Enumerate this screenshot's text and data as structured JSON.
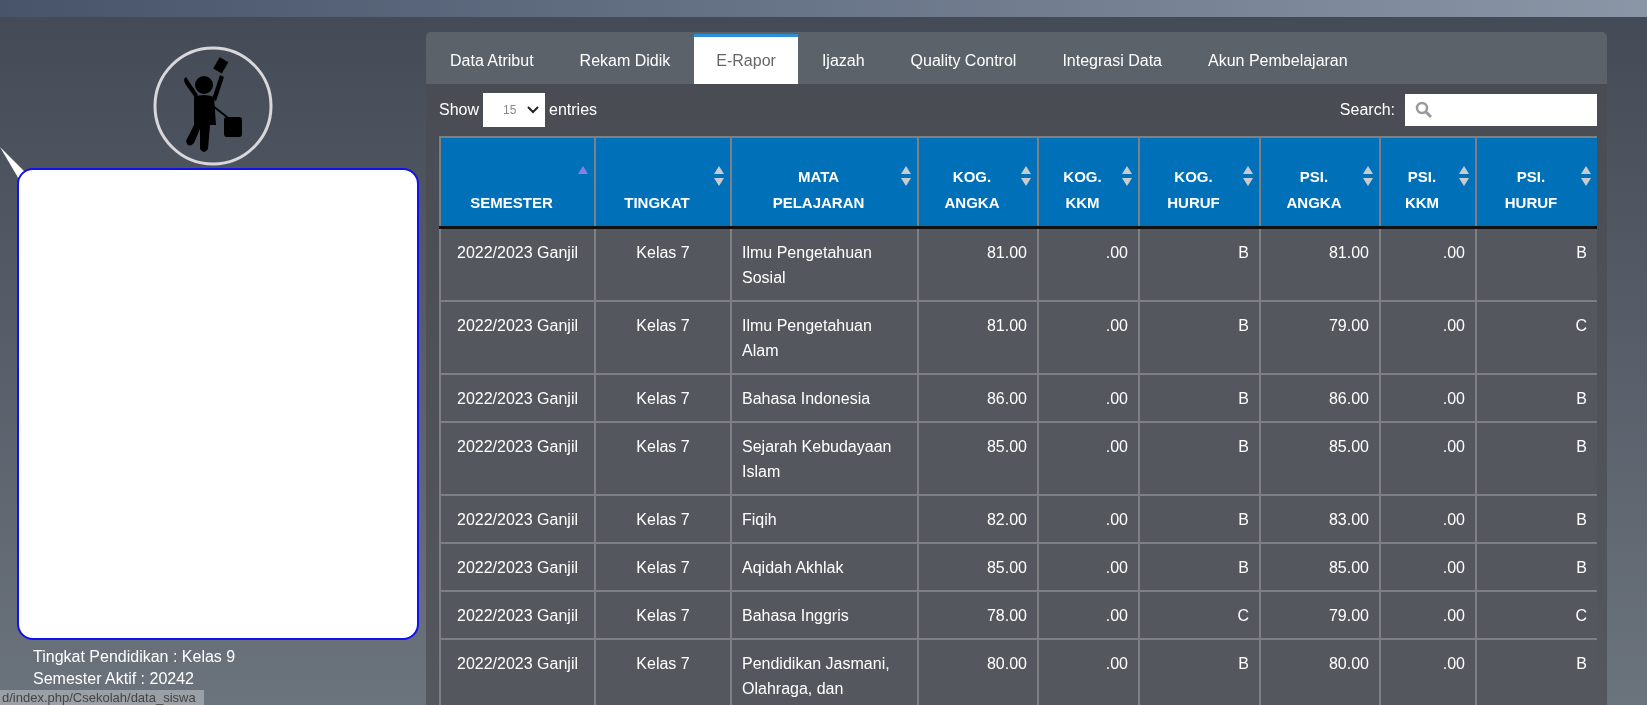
{
  "profile": {
    "details": [
      "Tingkat Pendidikan : Kelas 9",
      "Semester Aktif : 20242"
    ]
  },
  "status_url": "d/index.php/Csekolah/data_siswa",
  "tabs": [
    {
      "label": "Data Atribut",
      "selected": false
    },
    {
      "label": "Rekam Didik",
      "selected": false
    },
    {
      "label": "E-Rapor",
      "selected": true
    },
    {
      "label": "Ijazah",
      "selected": false
    },
    {
      "label": "Quality Control",
      "selected": false
    },
    {
      "label": "Integrasi Data",
      "selected": false
    },
    {
      "label": "Akun Pembelajaran",
      "selected": false
    }
  ],
  "length_menu": {
    "label_before": "Show",
    "value": "15",
    "label_after": "entries"
  },
  "search": {
    "label": "Search:"
  },
  "table": {
    "columns": [
      {
        "label": "SEMESTER",
        "sorted": true
      },
      {
        "label": "TINGKAT",
        "sorted": false
      },
      {
        "label": "MATA PELAJARAN",
        "sorted": false
      },
      {
        "label": "KOG. ANGKA",
        "sorted": false
      },
      {
        "label": "KOG. KKM",
        "sorted": false
      },
      {
        "label": "KOG. HURUF",
        "sorted": false
      },
      {
        "label": "PSI. ANGKA",
        "sorted": false
      },
      {
        "label": "PSI. KKM",
        "sorted": false
      },
      {
        "label": "PSI. HURUF",
        "sorted": false
      }
    ],
    "rows": [
      [
        "2022/2023 Ganjil",
        "Kelas 7",
        "Ilmu Pengetahuan Sosial",
        "81.00",
        ".00",
        "B",
        "81.00",
        ".00",
        "B"
      ],
      [
        "2022/2023 Ganjil",
        "Kelas 7",
        "Ilmu Pengetahuan Alam",
        "81.00",
        ".00",
        "B",
        "79.00",
        ".00",
        "C"
      ],
      [
        "2022/2023 Ganjil",
        "Kelas 7",
        "Bahasa Indonesia",
        "86.00",
        ".00",
        "B",
        "86.00",
        ".00",
        "B"
      ],
      [
        "2022/2023 Ganjil",
        "Kelas 7",
        "Sejarah Kebudayaan Islam",
        "85.00",
        ".00",
        "B",
        "85.00",
        ".00",
        "B"
      ],
      [
        "2022/2023 Ganjil",
        "Kelas 7",
        "Fiqih",
        "82.00",
        ".00",
        "B",
        "83.00",
        ".00",
        "B"
      ],
      [
        "2022/2023 Ganjil",
        "Kelas 7",
        "Aqidah Akhlak",
        "85.00",
        ".00",
        "B",
        "85.00",
        ".00",
        "B"
      ],
      [
        "2022/2023 Ganjil",
        "Kelas 7",
        "Bahasa Inggris",
        "78.00",
        ".00",
        "C",
        "79.00",
        ".00",
        "C"
      ],
      [
        "2022/2023 Ganjil",
        "Kelas 7",
        "Pendidikan Jasmani, Olahraga, dan",
        "80.00",
        ".00",
        "B",
        "80.00",
        ".00",
        "B"
      ]
    ]
  }
}
